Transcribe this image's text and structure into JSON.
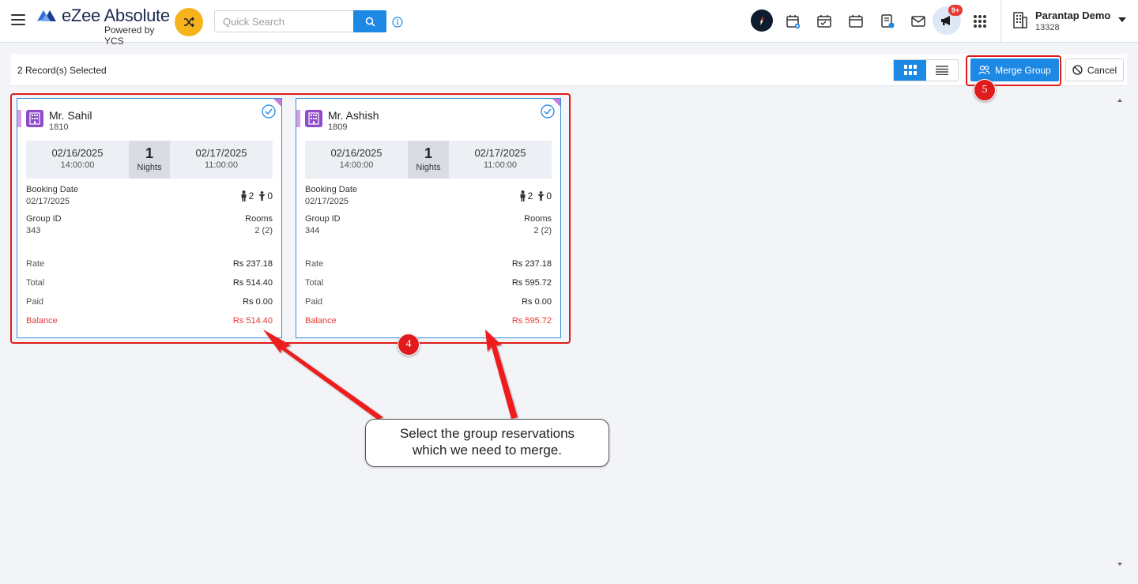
{
  "header": {
    "logo_name": "eZee Absolute",
    "logo_sub": "Powered by YCS",
    "search_placeholder": "Quick Search",
    "notification_badge": "9+",
    "user_name": "Parantap Demo",
    "user_code": "13328"
  },
  "toolbar": {
    "selected_text": "2 Record(s) Selected",
    "merge_label": "Merge Group",
    "cancel_label": "Cancel"
  },
  "cards": [
    {
      "name": "Mr. Sahil",
      "id": "1810",
      "arrival_date": "02/16/2025",
      "arrival_time": "14:00:00",
      "nights": "1",
      "nights_label": "Nights",
      "departure_date": "02/17/2025",
      "departure_time": "11:00:00",
      "booking_date_label": "Booking Date",
      "booking_date": "02/17/2025",
      "adults": "2",
      "children": "0",
      "group_id_label": "Group ID",
      "group_id": "343",
      "rooms_label": "Rooms",
      "rooms": "2 (2)",
      "rate_label": "Rate",
      "rate": "Rs 237.18",
      "total_label": "Total",
      "total": "Rs 514.40",
      "paid_label": "Paid",
      "paid": "Rs 0.00",
      "balance_label": "Balance",
      "balance": "Rs 514.40"
    },
    {
      "name": "Mr. Ashish",
      "id": "1809",
      "arrival_date": "02/16/2025",
      "arrival_time": "14:00:00",
      "nights": "1",
      "nights_label": "Nights",
      "departure_date": "02/17/2025",
      "departure_time": "11:00:00",
      "booking_date_label": "Booking Date",
      "booking_date": "02/17/2025",
      "adults": "2",
      "children": "0",
      "group_id_label": "Group ID",
      "group_id": "344",
      "rooms_label": "Rooms",
      "rooms": "2 (2)",
      "rate_label": "Rate",
      "rate": "Rs 237.18",
      "total_label": "Total",
      "total": "Rs 595.72",
      "paid_label": "Paid",
      "paid": "Rs 0.00",
      "balance_label": "Balance",
      "balance": "Rs 595.72"
    }
  ],
  "annotations": {
    "step_cards": "4",
    "step_merge": "5",
    "callout_line1": "Select the group reservations",
    "callout_line2": "which we need to merge."
  },
  "colors": {
    "primary": "#1e88e5",
    "balance": "#e53935",
    "annotation": "#e01b1b",
    "logo_accent": "#f6b31b"
  }
}
